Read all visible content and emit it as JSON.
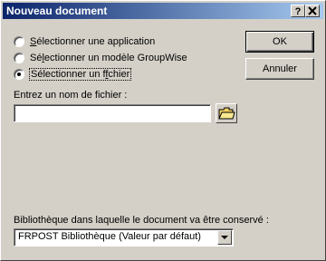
{
  "window": {
    "title": "Nouveau document",
    "help_label": "?",
    "close_label": "X"
  },
  "options": [
    {
      "label": "Sélectionner une application",
      "selected": false
    },
    {
      "label": "Sélectionner un modèle GroupWise",
      "selected": false
    },
    {
      "label": "Sélectionner un fichier",
      "selected": true
    }
  ],
  "buttons": {
    "ok_label": "OK",
    "cancel_label": "Annuler"
  },
  "filename": {
    "label": "Entrez un nom de fichier :",
    "value": ""
  },
  "library": {
    "label": "Bibliothèque dans laquelle le document va être conservé :",
    "selected": "FRPOST Bibliothèque  (Valeur par défaut)"
  },
  "colors": {
    "title_bar_start": "#0a246a",
    "title_bar_end": "#a6caf0",
    "face": "#d4d0c8",
    "folder": "#f0d060"
  }
}
